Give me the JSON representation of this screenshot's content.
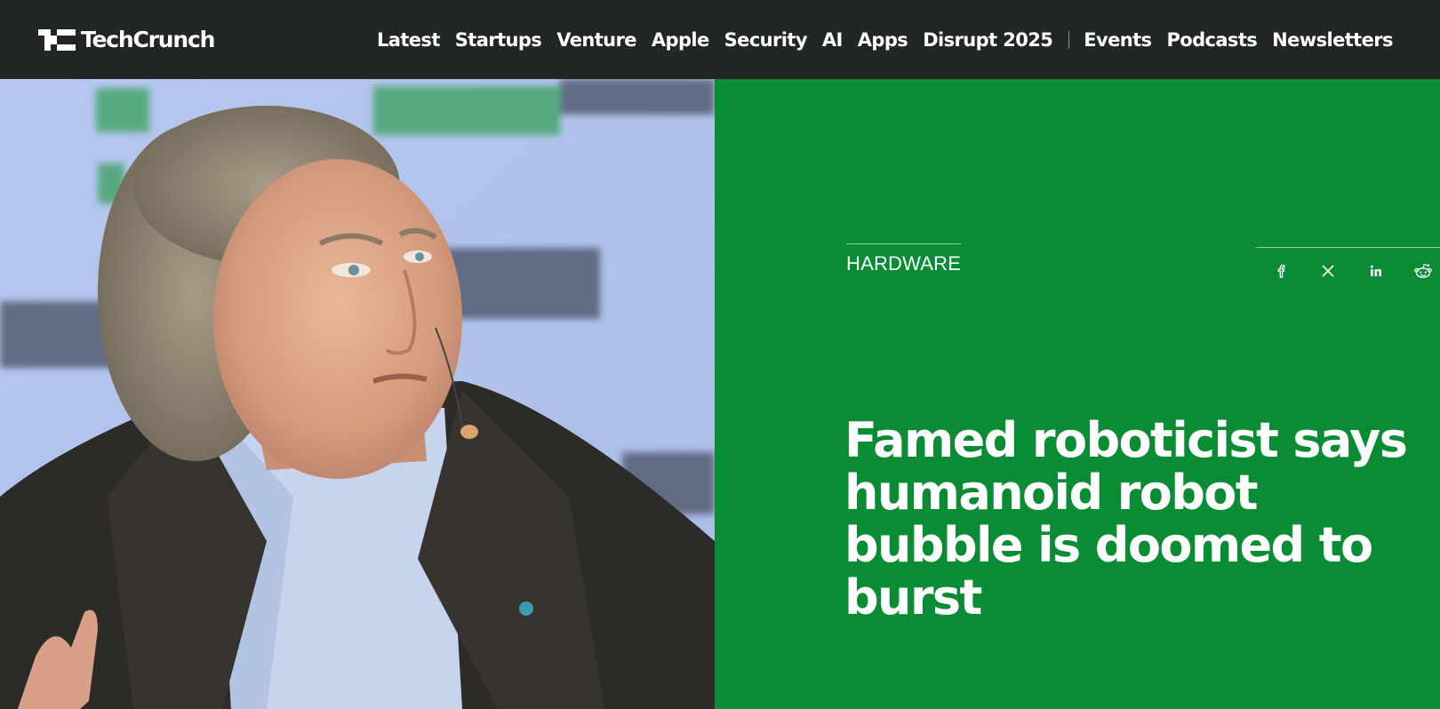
{
  "brand": {
    "name": "TechCrunch"
  },
  "nav": {
    "items": [
      "Latest",
      "Startups",
      "Venture",
      "Apple",
      "Security",
      "AI",
      "Apps",
      "Disrupt 2025"
    ],
    "secondary": [
      "Events",
      "Podcasts",
      "Newsletters"
    ]
  },
  "article": {
    "category": "HARDWARE",
    "headline": "Famed roboticist says humanoid robot bubble is doomed to burst"
  },
  "share": {
    "icons": [
      "facebook-icon",
      "x-icon",
      "linkedin-icon",
      "reddit-icon"
    ]
  },
  "colors": {
    "topbar": "#222624",
    "accent_green": "#0a8c35",
    "text": "#ffffff"
  }
}
